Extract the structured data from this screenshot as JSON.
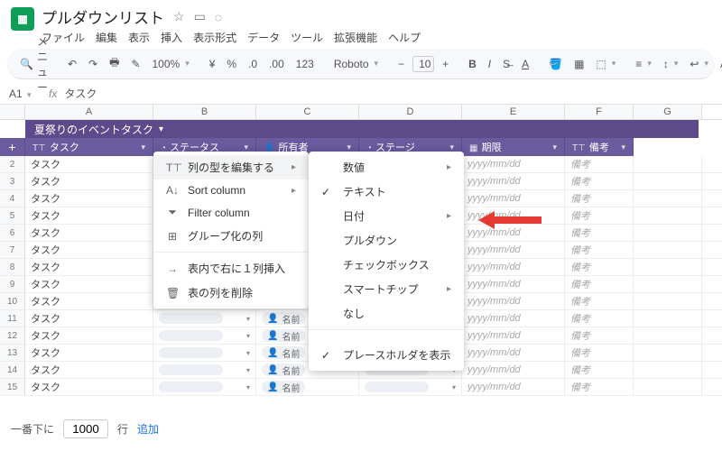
{
  "doc": {
    "title": "プルダウンリスト"
  },
  "menubar": [
    "ファイル",
    "編集",
    "表示",
    "挿入",
    "表示形式",
    "データ",
    "ツール",
    "拡張機能",
    "ヘルプ"
  ],
  "toolbar": {
    "menuSearch": "メニュー",
    "zoom": "100%",
    "currency": "¥",
    "percent": "%",
    "dec_dec": ".0",
    "dec_inc": ".00",
    "numfmt": "123",
    "font": "Roboto",
    "fontsize": "10"
  },
  "namebox": {
    "cell": "A1",
    "value": "タスク"
  },
  "columns": [
    "A",
    "B",
    "C",
    "D",
    "E",
    "F",
    "G"
  ],
  "banner": {
    "title": "夏祭りのイベントタスク"
  },
  "purpleHead": {
    "col1": "タスク",
    "col2": "ステータス",
    "col3": "所有者",
    "col4": "ステージ",
    "col5": "期限",
    "col6": "備考"
  },
  "rows": {
    "ids": [
      2,
      3,
      4,
      5,
      6,
      7,
      8,
      9,
      10,
      11,
      12,
      13,
      14,
      15
    ],
    "task": "タスク",
    "owner": "名前",
    "date": "yyyy/mm/dd",
    "note": "備考"
  },
  "footer": {
    "prefix": "一番下に",
    "count": "1000",
    "suffix": "行",
    "add": "追加"
  },
  "menu1": {
    "editType": "列の型を編集する",
    "sort": "Sort column",
    "filter": "Filter column",
    "group": "グループ化の列",
    "insertRight": "表内で右に１列挿入",
    "deleteCol": "表の列を削除"
  },
  "menu2": {
    "number": "数値",
    "text": "テキスト",
    "date": "日付",
    "dropdown": "プルダウン",
    "checkbox": "チェックボックス",
    "smartchip": "スマートチップ",
    "none": "なし",
    "showPlaceholder": "プレースホルダを表示"
  }
}
